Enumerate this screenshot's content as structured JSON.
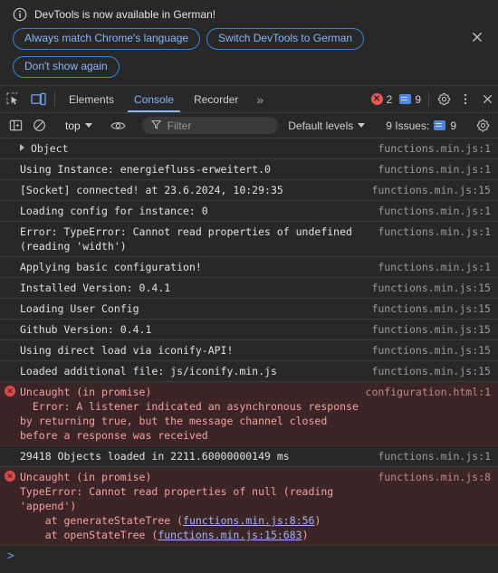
{
  "notification": {
    "icon": "info-icon",
    "text": "DevTools is now available in German!",
    "buttons": [
      {
        "label": "Always match Chrome's language"
      },
      {
        "label": "Switch DevTools to German"
      },
      {
        "label": "Don't show again"
      }
    ],
    "close_icon": "close-icon"
  },
  "tabbar": {
    "inspect_icon": "inspect-element-icon",
    "device_icon": "device-toolbar-icon",
    "tabs": [
      {
        "label": "Elements",
        "active": false
      },
      {
        "label": "Console",
        "active": true
      },
      {
        "label": "Recorder",
        "active": false
      }
    ],
    "more_tabs_label": "»",
    "error_count": "2",
    "message_count": "9",
    "settings_icon": "gear-icon",
    "more_icon": "kebab-menu-icon",
    "close_icon": "close-icon"
  },
  "filterbar": {
    "sidebar_icon": "console-sidebar-icon",
    "clear_icon": "clear-console-icon",
    "context": "top",
    "eye_icon": "live-expression-icon",
    "filter_icon": "filter-icon",
    "filter_value": "",
    "filter_placeholder": "Filter",
    "levels_label": "Default levels",
    "issues_label": "9 Issues:",
    "issues_count": "9",
    "settings_icon": "console-settings-icon"
  },
  "console": {
    "messages": [
      {
        "kind": "object",
        "text": "Object",
        "source": "functions.min.js:1"
      },
      {
        "kind": "log",
        "text": "Using Instance: energiefluss-erweitert.0",
        "source": "functions.min.js:1"
      },
      {
        "kind": "log",
        "text": "[Socket] connected! at 23.6.2024, 10:29:35",
        "source": "functions.min.js:15"
      },
      {
        "kind": "log",
        "text": "Loading config for instance: 0",
        "source": "functions.min.js:1"
      },
      {
        "kind": "log",
        "text": "Error: TypeError: Cannot read properties of undefined (reading 'width')",
        "source": "functions.min.js:1"
      },
      {
        "kind": "log",
        "text": "Applying basic configuration!",
        "source": "functions.min.js:1"
      },
      {
        "kind": "log",
        "text": "Installed Version: 0.4.1",
        "source": "functions.min.js:15"
      },
      {
        "kind": "log",
        "text": "Loading User Config",
        "source": "functions.min.js:15"
      },
      {
        "kind": "log",
        "text": "Github Version: 0.4.1",
        "source": "functions.min.js:15"
      },
      {
        "kind": "log",
        "text": "Using direct load via iconify-API!",
        "source": "functions.min.js:15"
      },
      {
        "kind": "log",
        "text": "Loaded additional file: js/iconify.min.js",
        "source": "functions.min.js:15"
      },
      {
        "kind": "error",
        "text": "Uncaught (in promise)\n  Error: A listener indicated an asynchronous response by returning true, but the message channel closed before a response was received",
        "source": "configuration.html:1"
      },
      {
        "kind": "log",
        "text": "29418 Objects loaded in 2211.60000000149 ms",
        "source": "functions.min.js:1"
      },
      {
        "kind": "error-stack",
        "head": "Uncaught (in promise)",
        "detail": "TypeError: Cannot read properties of null (reading 'append')",
        "frames": [
          {
            "prefix": "    at generateStateTree (",
            "link": "functions.min.js:8:56",
            "suffix": ")"
          },
          {
            "prefix": "    at openStateTree (",
            "link": "functions.min.js:15:683",
            "suffix": ")"
          }
        ],
        "source": "functions.min.js:8"
      }
    ],
    "prompt_caret": ">"
  },
  "colors": {
    "background": "#282828",
    "accent": "#8ab4f8",
    "error_bg": "#3c2527",
    "error_text": "#f5a0a0",
    "link": "#a6b6ef"
  }
}
